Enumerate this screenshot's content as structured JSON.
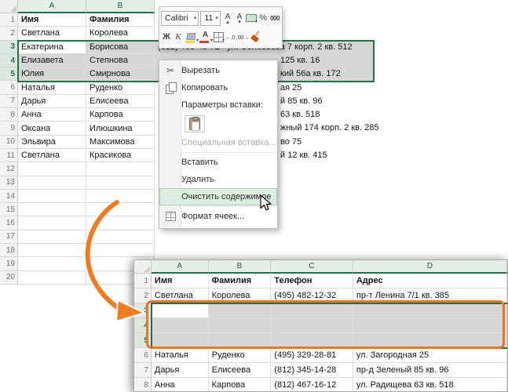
{
  "colors": {
    "excel_green": "#217346",
    "selection_border": "#1F7245",
    "selection_fill": "#D6D6D6",
    "menu_highlight": "#DEEDE2",
    "annotation_orange": "#ED7623",
    "arrow_orange": "#F07C21"
  },
  "main_sheet": {
    "col_headers": [
      "A",
      "B"
    ],
    "rows": [
      {
        "n": 1,
        "a": "Имя",
        "b": "Фамилия",
        "bold": true
      },
      {
        "n": 2,
        "a": "Светлана",
        "b": "Королева"
      },
      {
        "n": 3,
        "a": "Екатерина",
        "b": "Борисова",
        "selected": true,
        "active": true
      },
      {
        "n": 4,
        "a": "Елизавета",
        "b": "Степнова",
        "selected": true
      },
      {
        "n": 5,
        "a": "Юлия",
        "b": "Смирнова",
        "selected": true
      },
      {
        "n": 6,
        "a": "Наталья",
        "b": "Руденко"
      },
      {
        "n": 7,
        "a": "Дарья",
        "b": "Елисеева"
      },
      {
        "n": 8,
        "a": "Анна",
        "b": "Карпова"
      },
      {
        "n": 9,
        "a": "Оксана",
        "b": "Илюшкина"
      },
      {
        "n": 10,
        "a": "Эльвира",
        "b": "Максимова"
      },
      {
        "n": 11,
        "a": "Светлана",
        "b": "Красикова"
      },
      {
        "n": 12,
        "a": "",
        "b": ""
      },
      {
        "n": 13,
        "a": "",
        "b": ""
      },
      {
        "n": 14,
        "a": "",
        "b": ""
      },
      {
        "n": 15,
        "a": "",
        "b": ""
      },
      {
        "n": 16,
        "a": "",
        "b": ""
      },
      {
        "n": 17,
        "a": "",
        "b": ""
      },
      {
        "n": 18,
        "a": "",
        "b": ""
      },
      {
        "n": 19,
        "a": "",
        "b": ""
      },
      {
        "n": 20,
        "a": "",
        "b": ""
      }
    ],
    "c3": "(812) 463-48-72",
    "d3": "ул. Соловьева 7 корп. 2 кв. 512",
    "fragments": [
      {
        "row": 4,
        "text": "125 кв. 16"
      },
      {
        "row": 5,
        "text": "кий 56а кв. 172"
      },
      {
        "row": 6,
        "text": "ая 25"
      },
      {
        "row": 7,
        "text": "й 85 кв. 96"
      },
      {
        "row": 8,
        "text": "63 кв. 518"
      },
      {
        "row": 9,
        "text": "жный 174 корп. 2 кв. 285"
      },
      {
        "row": 10,
        "text": "во 75"
      },
      {
        "row": 11,
        "text": "й 12 кв. 415"
      }
    ]
  },
  "mini_toolbar": {
    "font_name": "Calibri",
    "font_size": "11",
    "row1_icons": [
      {
        "name": "grow-font-icon",
        "glyph": "A",
        "sub": "▴"
      },
      {
        "name": "shrink-font-icon",
        "glyph": "A",
        "sub": "▾"
      },
      {
        "name": "accounting-format-icon",
        "type": "currency",
        "caret": true
      },
      {
        "name": "percent-style-icon",
        "glyph": "%"
      },
      {
        "name": "comma-style-icon",
        "glyph": "000"
      }
    ],
    "row2_icons": [
      {
        "name": "bold-icon",
        "glyph": "Ж"
      },
      {
        "name": "italic-icon",
        "glyph": "К"
      },
      {
        "name": "fill-color-icon",
        "type": "fill",
        "caret": true
      },
      {
        "name": "font-color-icon",
        "type": "fontcolor",
        "glyph": "А",
        "caret": true
      },
      {
        "name": "borders-icon",
        "type": "borders",
        "caret": true
      },
      {
        "name": "increase-decimal-icon",
        "glyph": "←.0"
      },
      {
        "name": "decrease-decimal-icon",
        "glyph": ".00→"
      },
      {
        "name": "format-painter-icon",
        "type": "brush"
      }
    ]
  },
  "context_menu": {
    "items": [
      {
        "name": "cut",
        "label": "Вырезать",
        "icon": "scissors-icon"
      },
      {
        "name": "copy",
        "label": "Копировать",
        "icon": "copy-icon"
      },
      {
        "name": "paste-options-label",
        "label": "Параметры вставки:",
        "type": "label"
      },
      {
        "name": "paste-option",
        "type": "paste-option",
        "icon": "paste-icon"
      },
      {
        "name": "paste-special",
        "label": "Специальная вставка...",
        "disabled": true
      },
      {
        "type": "separator"
      },
      {
        "name": "insert",
        "label": "Вставить"
      },
      {
        "name": "delete",
        "label": "Удалить"
      },
      {
        "name": "clear-contents",
        "label": "Очистить содержимое",
        "highlighted": true
      },
      {
        "type": "separator"
      },
      {
        "name": "format-cells",
        "label": "Формат ячеек...",
        "icon": "format-cells-icon"
      }
    ]
  },
  "result_sheet": {
    "col_headers": [
      "A",
      "B",
      "C",
      "D"
    ],
    "rows": [
      {
        "n": 1,
        "a": "Имя",
        "b": "Фамилия",
        "c": "Телефон",
        "d": "Адрес",
        "bold": true
      },
      {
        "n": 2,
        "a": "Светлана",
        "b": "Королева",
        "c": "(495) 482-12-32",
        "d": "пр-т Ленина 7/1 кв. 385"
      },
      {
        "n": 3,
        "a": "",
        "b": "",
        "c": "",
        "d": "",
        "selected": true,
        "active": true
      },
      {
        "n": 4,
        "a": "",
        "b": "",
        "c": "",
        "d": "",
        "selected": true
      },
      {
        "n": 5,
        "a": "",
        "b": "",
        "c": "",
        "d": "",
        "selected": true
      },
      {
        "n": 6,
        "a": "Наталья",
        "b": "Руденко",
        "c": "(495) 329-28-81",
        "d": "ул. Загородная 25"
      },
      {
        "n": 7,
        "a": "Дарья",
        "b": "Елисеева",
        "c": "(812) 345-14-28",
        "d": "пр-д Зеленый 85 кв. 96"
      },
      {
        "n": 8,
        "a": "Анна",
        "b": "Карпова",
        "c": "(812) 467-16-12",
        "d": "ул. Радищева 63 кв. 518"
      }
    ]
  }
}
